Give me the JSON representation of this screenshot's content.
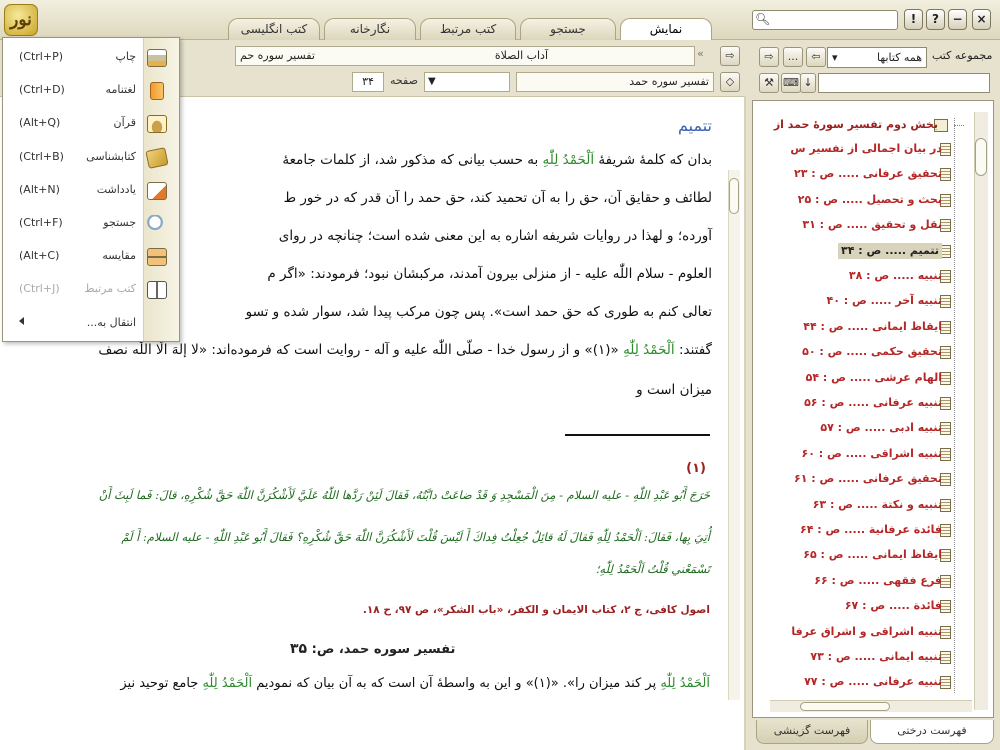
{
  "app": {
    "logo_text": "نور"
  },
  "tabs": [
    {
      "label": "نمایش",
      "active": true
    },
    {
      "label": "جستجو",
      "active": false
    },
    {
      "label": "کتب مرتبط",
      "active": false
    },
    {
      "label": "نگارخانه",
      "active": false
    },
    {
      "label": "کتب انگلیسی",
      "active": false
    }
  ],
  "window_buttons": {
    "help": "?",
    "info": "!",
    "minimize": "−",
    "close": "×"
  },
  "right_panel": {
    "collections_label": "مجموعه کتب",
    "collection_select": "همه کتابها",
    "more_label": "...",
    "tree_root": "بخش دوم تفسیر سورهٔ حمد از",
    "tree_items": [
      "در بیان اجمالی از تفسیر س",
      "تحقیق عرفانی ..... ص : ۲۳",
      "بحث و تحصیل ..... ص : ۲۵",
      "نقل و تحقیق ..... ص : ۳۱",
      "تتمیم ..... ص : ۳۴",
      "تنبیه ..... ص : ۳۸",
      "تنبیه آخر ..... ص : ۴۰",
      "ایقاظ ایمانی ..... ص : ۴۴",
      "تحقیق حکمی ..... ص : ۵۰",
      "الهام عرشی ..... ص : ۵۴",
      "تنبیه عرفانی ..... ص : ۵۶",
      "تنبیه ادبی ..... ص : ۵۷",
      "تنبیه اشراقی ..... ص : ۶۰",
      "تحقیق عرفانی ..... ص : ۶۱",
      "تنبیه و نکتة ..... ص : ۶۳",
      "فائدة عرفانية ..... ص : ۶۴",
      "ایقاظ ایمانی ..... ص : ۶۵",
      "فرع فقهی ..... ص : ۶۶",
      "فائدة ..... ص : ۶۷",
      "تنبیه اشراقی و اشراق عرفا",
      "تنبیه ایمانی ..... ص : ۷۳",
      "تنبیه عرفانی ..... ص : ۷۷"
    ],
    "selected_index": 4,
    "bottom_tabs": [
      "فهرست درختی",
      "فهرست گزینشی"
    ]
  },
  "main": {
    "breadcrumb_book": "آداب الصلاة",
    "breadcrumb_section": "تفسیر سوره حمد",
    "breadcrumb_section_short": "تفسیر سوره حم",
    "page_label": "صفحه",
    "page_number": "۳۴",
    "heading": "تتمیم",
    "lines": [
      [
        "بدان که کلمهٔ شریفهٔ ",
        "اَلْحَمْدُ لِلّٰهِ",
        " به حسب بیانی که مذکور شد، از کلمات جامعهٔ"
      ],
      [
        "لطائف و حقایق آن، حق را به آن تحمید کند، حق حمد را آن قدر که در خور ط"
      ],
      [
        "آورده؛ و لهذا در روایات شریفه اشاره به این معنی شده است؛ چنانچه در روای"
      ],
      [
        "العلوم - سلام اللّٰه علیه - از منزلی بیرون آمدند، مرکبشان نبود؛ فرمودند: «اگر م"
      ],
      [
        "تعالی کنم به طوری که حق حمد است». پس چون مرکب پیدا شد، سوار شده و تسو"
      ],
      [
        "گفتند: ",
        "اَلْحَمْدُ لِلّٰهِ",
        " «(۱)» و از رسول خدا - صلّی اللّٰه علیه و آله - روایت است که فرموده‌اند: «لا إلهَ الّا اللّٰه نصف"
      ],
      [
        "میزان است و"
      ]
    ],
    "footnote_marker": "(۱)",
    "footnote_arabic": [
      "خَرَجَ أَبُو عَبْدِ اللّٰهِ - علیه السلام - مِنَ الْمَسْجِدِ وَ قَدْ ضاعَتْ دابَّتُهُ، فَقالَ لَئِنْ رَدَّها اللّٰهُ عَلَيَّ لَأَشْكُرَنَّ اللّٰهَ حَقَّ شُكْرِهِ، قالَ: فَما لَبِثَ أَنْ",
      "أُتِيَ بِها، فَقالَ: اَلْحَمْدُ لِلّٰهِ فَقالَ لَهُ قائِلٌ جُعِلْتُ فِداكَ أَ لَيْسَ قُلْتَ لَأَشْكُرَنَّ اللّٰهَ حَقَّ شُكْرِهِ؟ فَقالَ أَبُو عَبْدِ اللّٰهِ - علیه السلام: أَ لَمْ",
      "تَسْمَعْني قُلْتُ اَلْحَمْدُ لِلّٰهِ؛"
    ],
    "footnote_source": "اصول کافی، ج ۲، کتاب الایمان و الکفر، «باب الشکر»، ص ۹۷، ح ۱۸.",
    "page_footer_title": "تفسیر سوره حمد، ص:",
    "page_footer_number": "۳۵",
    "next_page_line": [
      "اَلْحَمْدُ لِلّٰهِ",
      " پر کند میزان را». «(۱)» و این به واسطهٔ آن است که به آن بیان که نمودیم ",
      "اَلْحَمْدُ لِلّٰهِ",
      " جامع توحید نیز"
    ]
  },
  "context_menu": {
    "items": [
      {
        "label": "چاپ",
        "shortcut": "(Ctrl+P)",
        "icon": "printer-icon",
        "enabled": true
      },
      {
        "label": "لغتنامه",
        "shortcut": "(Ctrl+D)",
        "icon": "dictionary-icon",
        "enabled": true
      },
      {
        "label": "قرآن",
        "shortcut": "(Alt+Q)",
        "icon": "quran-icon",
        "enabled": true
      },
      {
        "label": "کتابشناسی",
        "shortcut": "(Ctrl+B)",
        "icon": "bibliography-icon",
        "enabled": true
      },
      {
        "label": "یادداشت",
        "shortcut": "(Alt+N)",
        "icon": "note-icon",
        "enabled": true
      },
      {
        "label": "جستجو",
        "shortcut": "(Ctrl+F)",
        "icon": "search-icon",
        "enabled": true
      },
      {
        "label": "مقایسه",
        "shortcut": "(Alt+C)",
        "icon": "compare-icon",
        "enabled": true
      },
      {
        "label": "کتب مرتبط",
        "shortcut": "(Ctrl+J)",
        "icon": "related-books-icon",
        "enabled": false
      },
      {
        "label": "انتقال به...",
        "shortcut": "",
        "icon": "",
        "enabled": true
      }
    ]
  },
  "colors": {
    "accent": "#b52626",
    "selected": "#d8d4bc",
    "heading": "#3b5fb0",
    "quran": "#2e8b2e"
  }
}
